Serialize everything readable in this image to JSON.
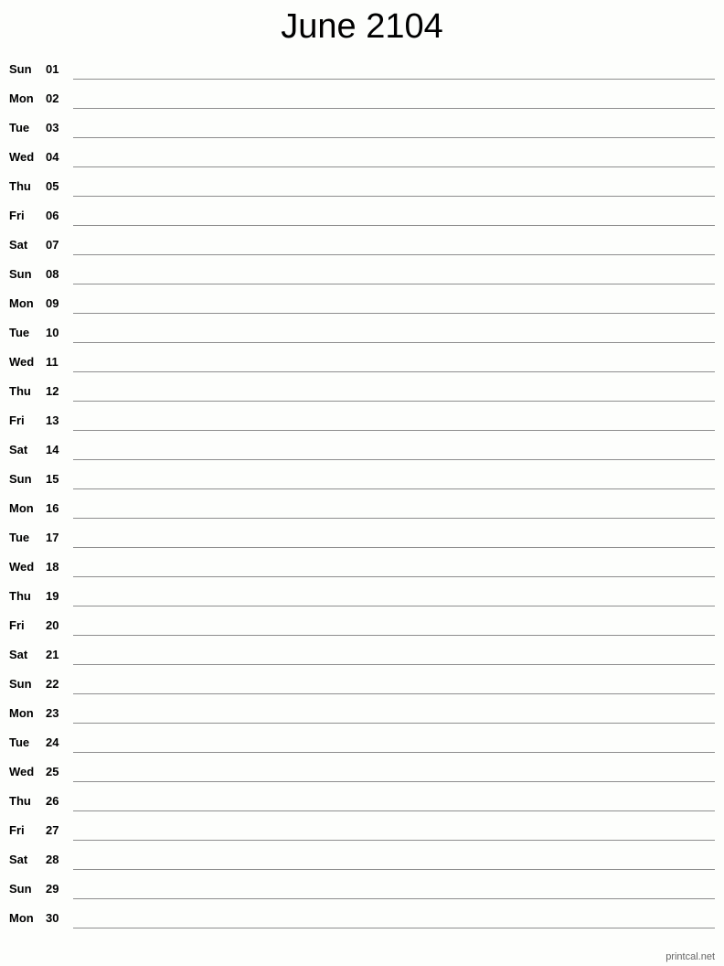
{
  "title": "June 2104",
  "days": [
    {
      "dow": "Sun",
      "num": "01"
    },
    {
      "dow": "Mon",
      "num": "02"
    },
    {
      "dow": "Tue",
      "num": "03"
    },
    {
      "dow": "Wed",
      "num": "04"
    },
    {
      "dow": "Thu",
      "num": "05"
    },
    {
      "dow": "Fri",
      "num": "06"
    },
    {
      "dow": "Sat",
      "num": "07"
    },
    {
      "dow": "Sun",
      "num": "08"
    },
    {
      "dow": "Mon",
      "num": "09"
    },
    {
      "dow": "Tue",
      "num": "10"
    },
    {
      "dow": "Wed",
      "num": "11"
    },
    {
      "dow": "Thu",
      "num": "12"
    },
    {
      "dow": "Fri",
      "num": "13"
    },
    {
      "dow": "Sat",
      "num": "14"
    },
    {
      "dow": "Sun",
      "num": "15"
    },
    {
      "dow": "Mon",
      "num": "16"
    },
    {
      "dow": "Tue",
      "num": "17"
    },
    {
      "dow": "Wed",
      "num": "18"
    },
    {
      "dow": "Thu",
      "num": "19"
    },
    {
      "dow": "Fri",
      "num": "20"
    },
    {
      "dow": "Sat",
      "num": "21"
    },
    {
      "dow": "Sun",
      "num": "22"
    },
    {
      "dow": "Mon",
      "num": "23"
    },
    {
      "dow": "Tue",
      "num": "24"
    },
    {
      "dow": "Wed",
      "num": "25"
    },
    {
      "dow": "Thu",
      "num": "26"
    },
    {
      "dow": "Fri",
      "num": "27"
    },
    {
      "dow": "Sat",
      "num": "28"
    },
    {
      "dow": "Sun",
      "num": "29"
    },
    {
      "dow": "Mon",
      "num": "30"
    }
  ],
  "footer": "printcal.net"
}
